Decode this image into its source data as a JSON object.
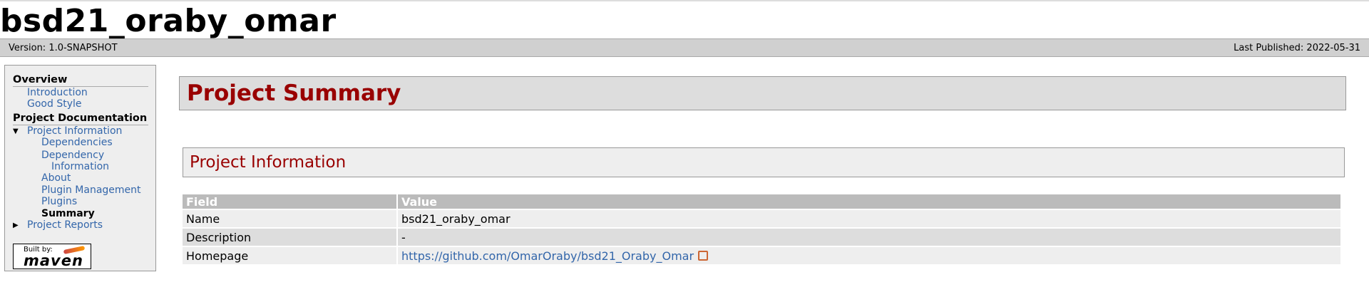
{
  "site": {
    "title": "bsd21_oraby_omar"
  },
  "breadcrumbs": {
    "version": "Version: 1.0-SNAPSHOT",
    "published": "Last Published: 2022-05-31"
  },
  "sidebar": {
    "overview_heading": "Overview",
    "overview_items": [
      "Introduction",
      "Good Style"
    ],
    "docs_heading": "Project Documentation",
    "project_info": "Project Information",
    "info_items": [
      "Dependencies",
      "Dependency",
      "Information",
      "About",
      "Plugin Management",
      "Plugins",
      "Summary"
    ],
    "project_reports": "Project Reports",
    "built_by_small": "Built by:",
    "built_by_big": "maven"
  },
  "main": {
    "title": "Project Summary",
    "section": "Project Information",
    "table": {
      "headers": [
        "Field",
        "Value"
      ],
      "rows": [
        [
          "Name",
          "bsd21_oraby_omar"
        ],
        [
          "Description",
          "-"
        ],
        [
          "Homepage",
          "https://github.com/OmarOraby/bsd21_Oraby_Omar"
        ]
      ]
    }
  }
}
